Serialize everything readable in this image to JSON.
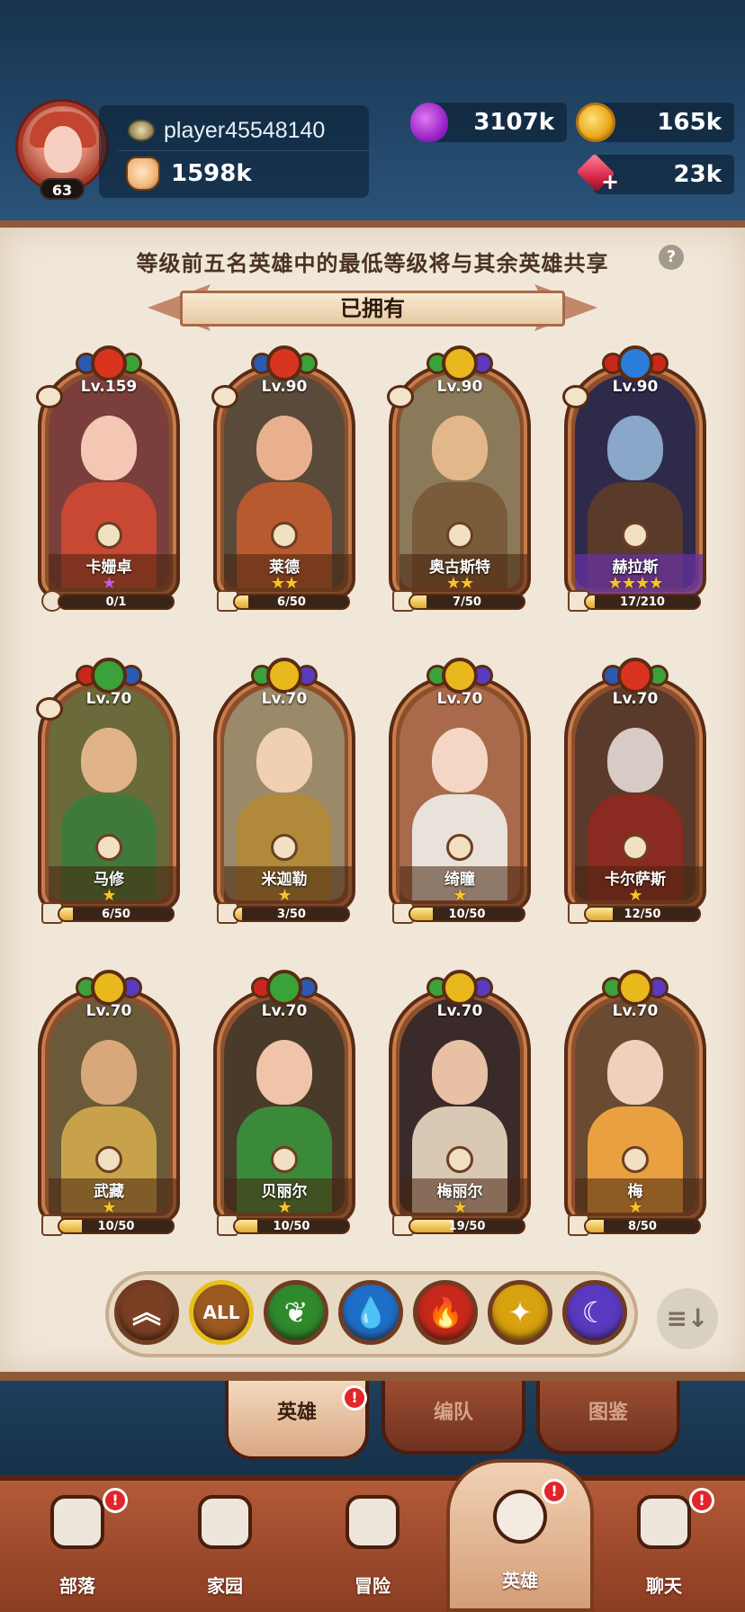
{
  "profile": {
    "level": "63",
    "player_name": "player45548140",
    "power": "1598k"
  },
  "resources": {
    "elixir": "3107k",
    "gold": "165k",
    "gems": "23k"
  },
  "notice_text": "等级前五名英雄中的最低等级将与其余英雄共享",
  "help_icon": "?",
  "section_title": "已拥有",
  "heroes": [
    {
      "level": "Lv.159",
      "name": "卡姗卓",
      "stars": "★",
      "star_color": "purple",
      "shards": "0/1",
      "progress": 0,
      "element": "fire",
      "party": true
    },
    {
      "level": "Lv.90",
      "name": "莱德",
      "stars": "★★",
      "star_color": "gold",
      "shards": "6/50",
      "progress": 0.12,
      "element": "fire",
      "party": true
    },
    {
      "level": "Lv.90",
      "name": "奥古斯特",
      "stars": "★★",
      "star_color": "gold",
      "shards": "7/50",
      "progress": 0.14,
      "element": "light",
      "party": true
    },
    {
      "level": "Lv.90",
      "name": "赫拉斯",
      "stars": "★★★★",
      "star_color": "gold",
      "shards": "17/210",
      "progress": 0.08,
      "element": "water",
      "party": true
    },
    {
      "level": "Lv.70",
      "name": "马修",
      "stars": "★",
      "star_color": "gold",
      "shards": "6/50",
      "progress": 0.12,
      "element": "nature",
      "party": true
    },
    {
      "level": "Lv.70",
      "name": "米迦勒",
      "stars": "★",
      "star_color": "gold",
      "shards": "3/50",
      "progress": 0.06,
      "element": "light",
      "party": false
    },
    {
      "level": "Lv.70",
      "name": "绮瞳",
      "stars": "★",
      "star_color": "gold",
      "shards": "10/50",
      "progress": 0.2,
      "element": "light",
      "party": false
    },
    {
      "level": "Lv.70",
      "name": "卡尔萨斯",
      "stars": "★",
      "star_color": "gold",
      "shards": "12/50",
      "progress": 0.24,
      "element": "fire",
      "party": false
    },
    {
      "level": "Lv.70",
      "name": "武藏",
      "stars": "★",
      "star_color": "gold",
      "shards": "10/50",
      "progress": 0.2,
      "element": "light",
      "party": false
    },
    {
      "level": "Lv.70",
      "name": "贝丽尔",
      "stars": "★",
      "star_color": "gold",
      "shards": "10/50",
      "progress": 0.2,
      "element": "nature",
      "party": false
    },
    {
      "level": "Lv.70",
      "name": "梅丽尔",
      "stars": "★",
      "star_color": "gold",
      "shards": "19/50",
      "progress": 0.38,
      "element": "light",
      "party": false
    },
    {
      "level": "Lv.70",
      "name": "梅",
      "stars": "★",
      "star_color": "gold",
      "shards": "8/50",
      "progress": 0.16,
      "element": "light",
      "party": false
    }
  ],
  "filters": [
    {
      "id": "rarity",
      "label": "︽",
      "color": "#7a4024"
    },
    {
      "id": "all",
      "label": "ALL",
      "color": "#9c5a20"
    },
    {
      "id": "nature",
      "label": "❦",
      "color": "#2f8a2c"
    },
    {
      "id": "water",
      "label": "💧",
      "color": "#1f6fc8"
    },
    {
      "id": "fire",
      "label": "🔥",
      "color": "#c8281c"
    },
    {
      "id": "light",
      "label": "✦",
      "color": "#d9a210"
    },
    {
      "id": "dark",
      "label": "☾",
      "color": "#5a3ac0"
    }
  ],
  "sort_label": "≡↓",
  "subtabs": [
    {
      "label": "英雄",
      "active": true,
      "alert": "!"
    },
    {
      "label": "编队",
      "active": false
    },
    {
      "label": "图鉴",
      "active": false
    }
  ],
  "nav": [
    {
      "label": "部落",
      "icon": "shield-icon",
      "alert": "!"
    },
    {
      "label": "家园",
      "icon": "house-icon"
    },
    {
      "label": "冒险",
      "icon": "crossed-swords-icon"
    },
    {
      "label": "英雄",
      "icon": "viking-helmet-icon",
      "alert": "!",
      "active": true
    },
    {
      "label": "聊天",
      "icon": "chat-bubble-icon",
      "alert": "!"
    }
  ],
  "colors": {
    "fire": "#d8341f",
    "water": "#2a7ed8",
    "nature": "#3aa238",
    "light": "#e8b81c",
    "dark": "#5a3ac0"
  }
}
